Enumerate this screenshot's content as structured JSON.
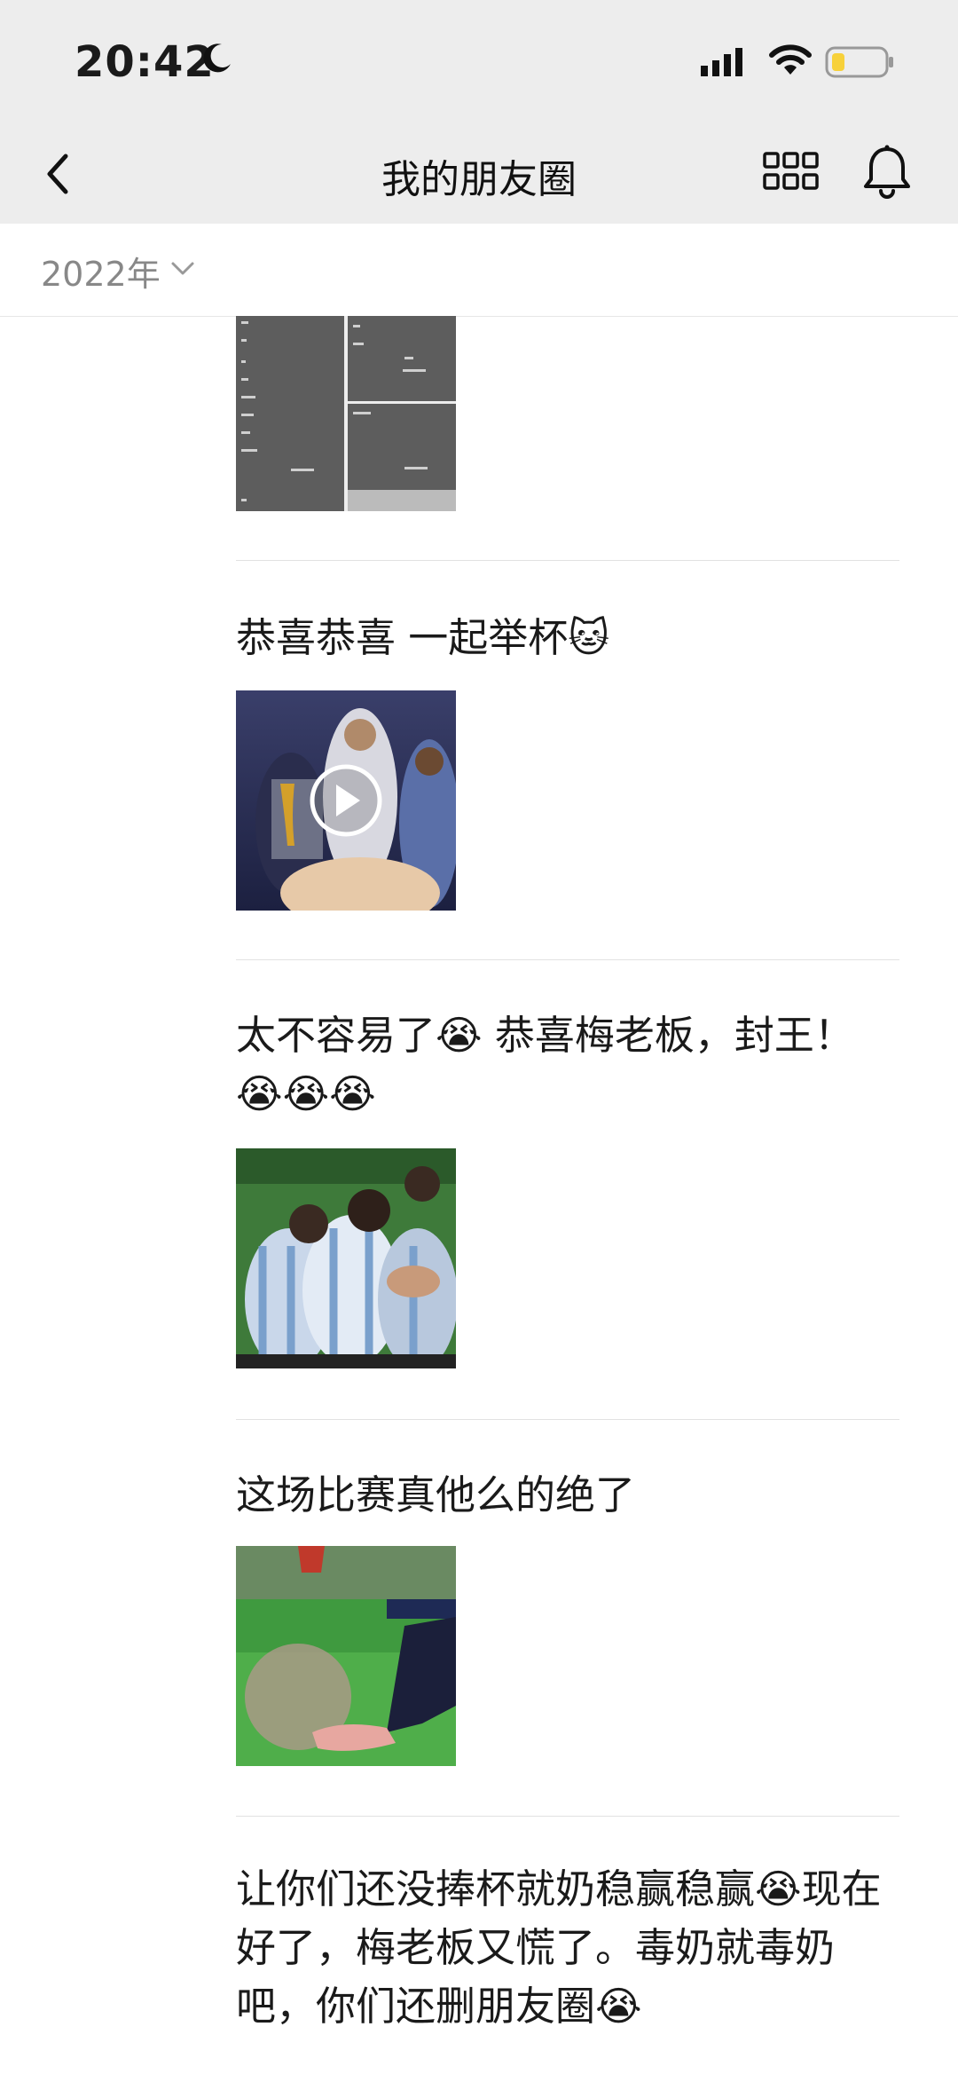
{
  "status_bar": {
    "time": "20:42"
  },
  "nav": {
    "title": "我的朋友圈"
  },
  "filter": {
    "year": "2022年"
  },
  "posts": [
    {
      "text": ""
    },
    {
      "text": "恭喜恭喜 一起举杯🐱"
    },
    {
      "text": "太不容易了😭 恭喜梅老板，封王！😭😭😭"
    },
    {
      "text": "这场比赛真他么的绝了"
    },
    {
      "text": "让你们还没捧杯就奶稳赢稳赢😭现在好了，梅老板又慌了。毒奶就毒奶吧，你们还删朋友圈😭"
    }
  ],
  "colors": {
    "bar_bg": "#ededed",
    "accent_green": "#07c160",
    "battery_yellow": "#f7d13a"
  }
}
